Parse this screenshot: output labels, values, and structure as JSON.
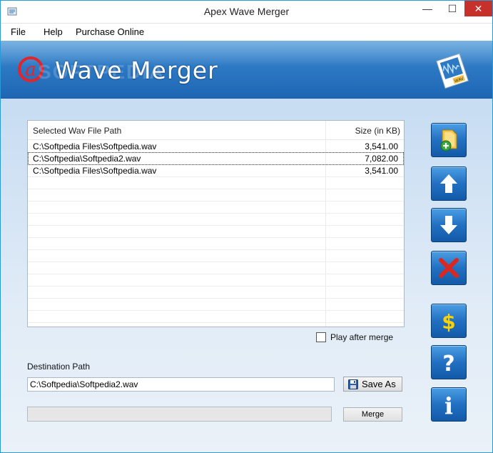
{
  "window": {
    "title": "Apex Wave Merger",
    "controls": {
      "minimize": "—",
      "maximize": "☐",
      "close": "✕"
    }
  },
  "menu": [
    "File",
    "Help",
    "Purchase Online"
  ],
  "banner": {
    "title": "Wave Merger",
    "watermark": "SOFTPEDIA"
  },
  "file_list": {
    "columns": [
      "Selected Wav File Path",
      "Size (in KB)"
    ],
    "rows": [
      {
        "path": "C:\\Softpedia Files\\Softpedia.wav",
        "size": "3,541.00",
        "selected": false
      },
      {
        "path": "C:\\Softpedia\\Softpedia2.wav",
        "size": "7,082.00",
        "selected": true
      },
      {
        "path": "C:\\Softpedia Files\\Softpedia.wav",
        "size": "3,541.00",
        "selected": false
      }
    ]
  },
  "play_after_merge": {
    "label": "Play after merge",
    "checked": false
  },
  "destination": {
    "label": "Destination Path",
    "value": "C:\\Softpedia\\Softpedia2.wav",
    "save_as_label": "Save As"
  },
  "merge": {
    "label": "Merge",
    "progress": 0
  },
  "side_buttons": [
    "add-files-icon",
    "move-up-icon",
    "move-down-icon",
    "remove-icon",
    "buy-icon",
    "help-icon",
    "info-icon"
  ],
  "colors": {
    "accent": "#2270c2",
    "close_red": "#c7312c",
    "remove_red": "#d9281f",
    "buy_yellow": "#f7d10a"
  }
}
